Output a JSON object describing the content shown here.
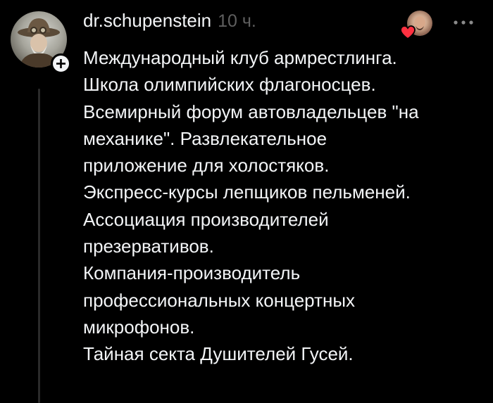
{
  "post": {
    "author": "dr.schupenstein",
    "timestamp": "10 ч.",
    "lines": [
      "Международный клуб армрестлинга.",
      "Школа олимпийских флагоносцев.",
      "Всемирный форум автовладельцев \"на",
      "механике\". Развлекательное",
      "приложение для холостяков.",
      "Экспресс-курсы лепщиков пельменей.",
      "Ассоциация производителей",
      "презервативов.",
      "Компания-производитель",
      "профессиональных концертных",
      "микрофонов.",
      "Тайная секта Душителей Гусей."
    ]
  },
  "icons": {
    "follow": "plus-icon",
    "liked": "heart-icon",
    "more": "more-options-icon"
  },
  "colors": {
    "background": "#000000",
    "text": "#f3f5f7",
    "muted": "#5f5f5f",
    "thread_line": "#2b2b2b",
    "heart": "#ff3040"
  }
}
